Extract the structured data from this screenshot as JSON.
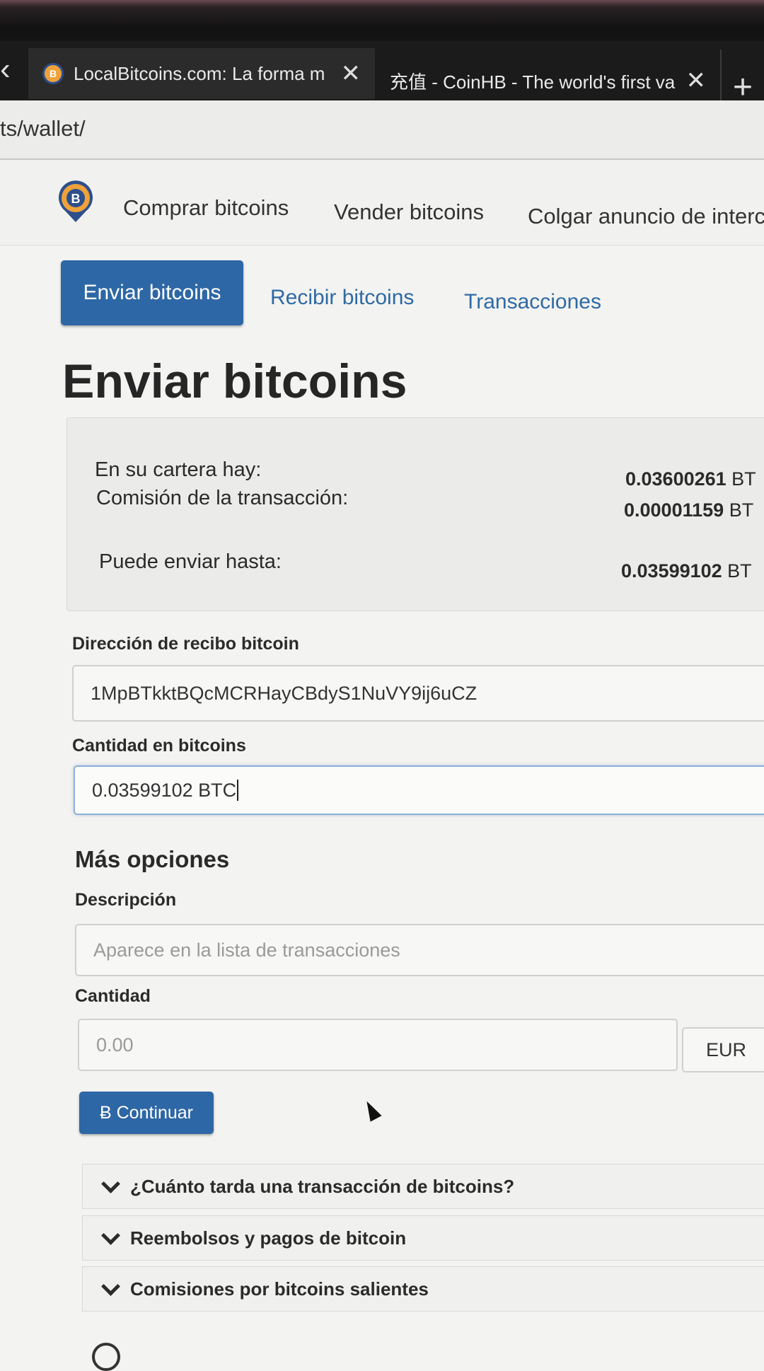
{
  "browser": {
    "back_glyph": "‹",
    "tabs": [
      {
        "title": "LocalBitcoins.com: La forma m",
        "favicon": "bitcoin-favicon-icon",
        "close": "✕"
      },
      {
        "title": "充值 - CoinHB - The world's first va",
        "close": "✕"
      }
    ],
    "new_tab": "+",
    "url": "ts/wallet/"
  },
  "site_nav": {
    "logo_icon": "localbitcoins-logo-icon",
    "items": [
      "Comprar bitcoins",
      "Vender bitcoins",
      "Colgar anuncio de interca"
    ]
  },
  "wallet_tabs": [
    "Enviar bitcoins",
    "Recibir bitcoins",
    "Transacciones"
  ],
  "page_title": "Enviar bitcoins",
  "balance": {
    "wallet_label": "En su cartera hay:",
    "wallet_value": "0.03600261",
    "wallet_unit": "BT",
    "fee_label": "Comisión de la transacción:",
    "fee_value": "0.00001159",
    "fee_unit": "BT",
    "max_label": "Puede enviar hasta:",
    "max_value": "0.03599102",
    "max_unit": "BT"
  },
  "form": {
    "address_label": "Dirección de recibo bitcoin",
    "address_value": "1MpBTkktBQcMCRHayCBdyS1NuVY9ij6uCZ",
    "amount_label": "Cantidad en bitcoins",
    "amount_value": "0.03599102 BTC",
    "more_options_heading": "Más opciones",
    "description_label": "Descripción",
    "description_placeholder": "Aparece en la lista de transacciones",
    "fiat_amount_label": "Cantidad",
    "fiat_amount_placeholder": "0.00",
    "currency": "EUR",
    "continue_button": "Ƀ Continuar"
  },
  "faq": [
    "¿Cuánto tarda una transacción de bitcoins?",
    "Reembolsos y pagos de bitcoin",
    "Comisiones por bitcoins salientes"
  ],
  "colors": {
    "primary": "#2e67a5",
    "page_bg": "#f3f3f1"
  }
}
